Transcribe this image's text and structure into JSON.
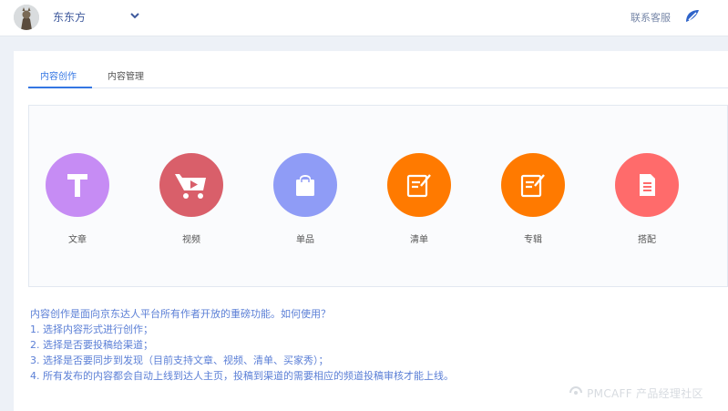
{
  "header": {
    "username": "东东方",
    "contact_label": "联系客服"
  },
  "tabs": [
    {
      "label": "内容创作",
      "active": true
    },
    {
      "label": "内容管理",
      "active": false
    }
  ],
  "create_items": [
    {
      "label": "文章",
      "icon": "text-T-icon",
      "color": "#c68cf4"
    },
    {
      "label": "视频",
      "icon": "video-cart-icon",
      "color": "#d95f6a"
    },
    {
      "label": "单品",
      "icon": "shopping-bag-icon",
      "color": "#8f9cf6"
    },
    {
      "label": "清单",
      "icon": "edit-list-icon",
      "color": "#ff7a00"
    },
    {
      "label": "专辑",
      "icon": "edit-album-icon",
      "color": "#ff7a00"
    },
    {
      "label": "搭配",
      "icon": "document-icon",
      "color": "#ff6b6b"
    }
  ],
  "description": [
    "内容创作是面向京东达人平台所有作者开放的重磅功能。如何使用？",
    "1. 选择内容形式进行创作；",
    "2. 选择是否要投稿给渠道；",
    "3. 选择是否要同步到发现（目前支持文章、视频、清单、买家秀）；",
    "4. 所有发布的内容都会自动上线到达人主页，投稿到渠道的需要相应的频道投稿审核才能上线。"
  ],
  "watermark": "PMCAFF 产品经理社区"
}
